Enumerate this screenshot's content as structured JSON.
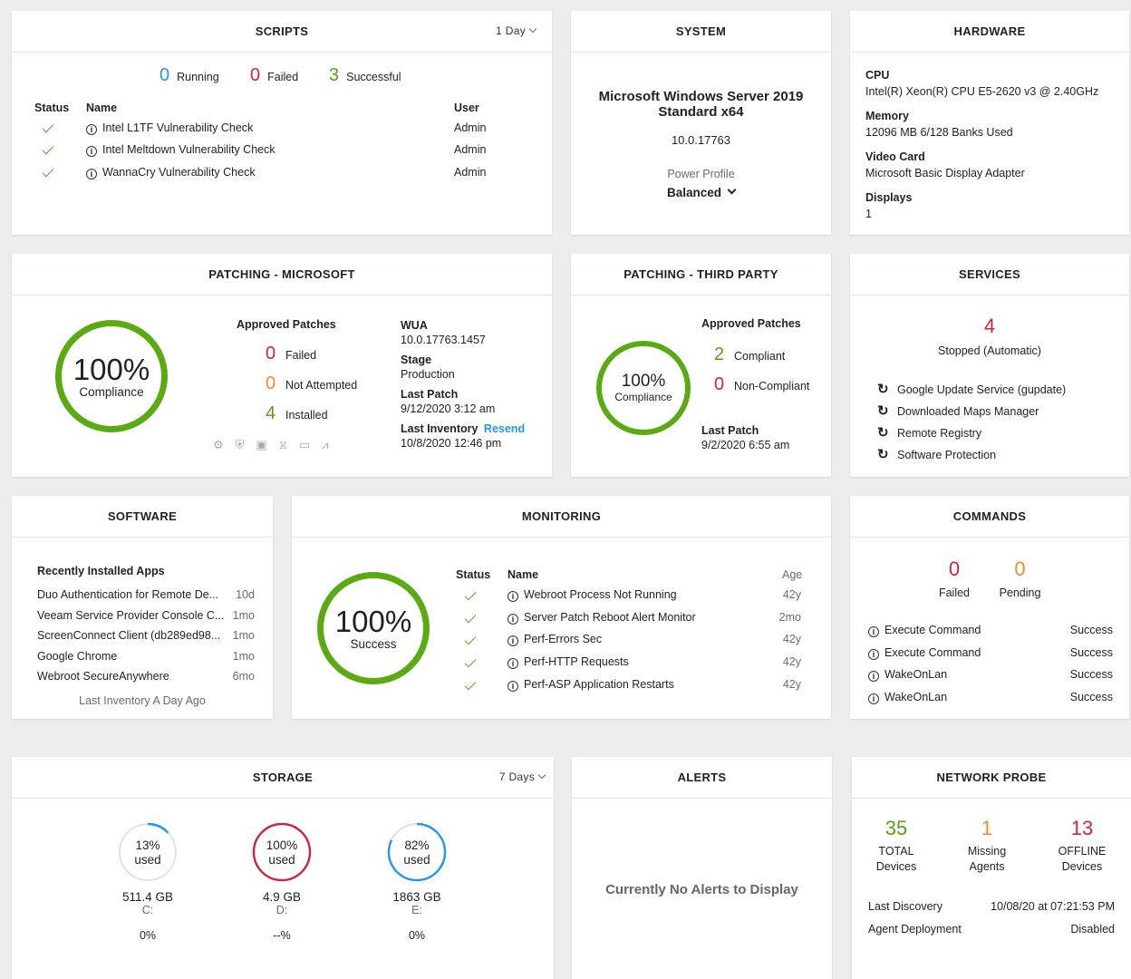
{
  "scripts": {
    "title": "SCRIPTS",
    "range": "1 Day",
    "running_count": "0",
    "running_label": "Running",
    "failed_count": "0",
    "failed_label": "Failed",
    "success_count": "3",
    "success_label": "Successful",
    "headers": {
      "status": "Status",
      "name": "Name",
      "user": "User"
    },
    "rows": [
      {
        "name": "Intel L1TF Vulnerability Check",
        "user": "Admin"
      },
      {
        "name": "Intel Meltdown Vulnerability Check",
        "user": "Admin"
      },
      {
        "name": "WannaCry Vulnerability Check",
        "user": "Admin"
      }
    ]
  },
  "system": {
    "title": "SYSTEM",
    "os_line1": "Microsoft Windows Server 2019",
    "os_line2": "Standard x64",
    "version": "10.0.17763",
    "power_label": "Power Profile",
    "power_value": "Balanced"
  },
  "hardware": {
    "title": "HARDWARE",
    "cpu_label": "CPU",
    "cpu_value": "Intel(R) Xeon(R) CPU E5-2620 v3 @ 2.40GHz",
    "memory_label": "Memory",
    "memory_value": "12096 MB 6/128 Banks Used",
    "video_label": "Video Card",
    "video_value": "Microsoft Basic Display Adapter",
    "displays_label": "Displays",
    "displays_value": "1"
  },
  "patch_ms": {
    "title": "PATCHING - MICROSOFT",
    "percent": "100%",
    "compliance": "Compliance",
    "approved_label": "Approved Patches",
    "failed_count": "0",
    "failed_label": "Failed",
    "notattempted_count": "0",
    "notattempted_label": "Not Attempted",
    "installed_count": "4",
    "installed_label": "Installed",
    "wua_label": "WUA",
    "wua_value": "10.0.17763.1457",
    "stage_label": "Stage",
    "stage_value": "Production",
    "lastpatch_label": "Last Patch",
    "lastpatch_value": "9/12/2020 3:12 am",
    "lastinv_label": "Last Inventory",
    "resend": "Resend",
    "lastinv_value": "10/8/2020 12:46 pm"
  },
  "patch_tp": {
    "title": "PATCHING - THIRD PARTY",
    "percent": "100%",
    "compliance": "Compliance",
    "approved_label": "Approved Patches",
    "compliant_count": "2",
    "compliant_label": "Compliant",
    "noncompliant_count": "0",
    "noncompliant_label": "Non-Compliant",
    "lastpatch_label": "Last Patch",
    "lastpatch_value": "9/2/2020 6:55 am"
  },
  "services": {
    "title": "SERVICES",
    "stopped_count": "4",
    "stopped_label": "Stopped (Automatic)",
    "items": [
      "Google Update Service (gupdate)",
      "Downloaded Maps Manager",
      "Remote Registry",
      "Software Protection"
    ]
  },
  "software": {
    "title": "SOFTWARE",
    "recent_label": "Recently Installed Apps",
    "apps": [
      {
        "name": "Duo Authentication for Remote De...",
        "age": "10d"
      },
      {
        "name": "Veeam Service Provider Console C...",
        "age": "1mo"
      },
      {
        "name": "ScreenConnect Client (db289ed98...",
        "age": "1mo"
      },
      {
        "name": "Google Chrome",
        "age": "1mo"
      },
      {
        "name": "Webroot SecureAnywhere",
        "age": "6mo"
      }
    ],
    "last_inventory": "Last Inventory A Day Ago"
  },
  "monitoring": {
    "title": "MONITORING",
    "percent": "100%",
    "success": "Success",
    "headers": {
      "status": "Status",
      "name": "Name",
      "age": "Age"
    },
    "rows": [
      {
        "name": "Webroot Process Not Running",
        "age": "42y"
      },
      {
        "name": "Server Patch Reboot Alert Monitor",
        "age": "2mo"
      },
      {
        "name": "Perf-Errors Sec",
        "age": "42y"
      },
      {
        "name": "Perf-HTTP Requests",
        "age": "42y"
      },
      {
        "name": "Perf-ASP Application Restarts",
        "age": "42y"
      }
    ]
  },
  "commands": {
    "title": "COMMANDS",
    "failed_count": "0",
    "failed_label": "Failed",
    "pending_count": "0",
    "pending_label": "Pending",
    "rows": [
      {
        "name": "Execute Command",
        "status": "Success"
      },
      {
        "name": "Execute Command",
        "status": "Success"
      },
      {
        "name": "WakeOnLan",
        "status": "Success"
      },
      {
        "name": "WakeOnLan",
        "status": "Success"
      }
    ]
  },
  "storage": {
    "title": "STORAGE",
    "range": "7 Days",
    "drives": [
      {
        "pct": "13%",
        "used": "used",
        "size": "511.4 GB",
        "letter": "C:",
        "change": "0%",
        "fraction": 0.13,
        "color": "#2196f3"
      },
      {
        "pct": "100%",
        "used": "used",
        "size": "4.9 GB",
        "letter": "D:",
        "change": "--%",
        "fraction": 1.0,
        "color": "#d0243b"
      },
      {
        "pct": "82%",
        "used": "used",
        "size": "1863 GB",
        "letter": "E:",
        "change": "0%",
        "fraction": 0.82,
        "color": "#2196f3"
      }
    ]
  },
  "alerts": {
    "title": "ALERTS",
    "message": "Currently No Alerts to Display"
  },
  "network": {
    "title": "NETWORK PROBE",
    "total_count": "35",
    "total_l1": "TOTAL",
    "total_l2": "Devices",
    "missing_count": "1",
    "missing_l1": "Missing",
    "missing_l2": "Agents",
    "offline_count": "13",
    "offline_l1": "OFFLINE",
    "offline_l2": "Devices",
    "discovery_label": "Last Discovery",
    "discovery_value": "10/08/20 at 07:21:53 PM",
    "deploy_label": "Agent Deployment",
    "deploy_value": "Disabled"
  }
}
